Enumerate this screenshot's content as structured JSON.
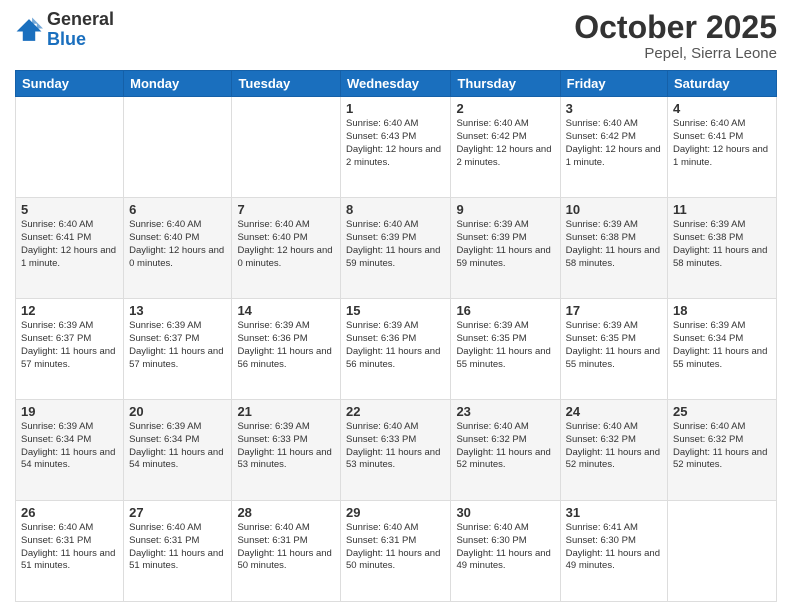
{
  "header": {
    "logo": {
      "general": "General",
      "blue": "Blue"
    },
    "title": "October 2025",
    "location": "Pepel, Sierra Leone"
  },
  "calendar": {
    "days": [
      "Sunday",
      "Monday",
      "Tuesday",
      "Wednesday",
      "Thursday",
      "Friday",
      "Saturday"
    ],
    "weeks": [
      [
        {
          "day": "",
          "info": ""
        },
        {
          "day": "",
          "info": ""
        },
        {
          "day": "",
          "info": ""
        },
        {
          "day": "1",
          "info": "Sunrise: 6:40 AM\nSunset: 6:43 PM\nDaylight: 12 hours\nand 2 minutes."
        },
        {
          "day": "2",
          "info": "Sunrise: 6:40 AM\nSunset: 6:42 PM\nDaylight: 12 hours\nand 2 minutes."
        },
        {
          "day": "3",
          "info": "Sunrise: 6:40 AM\nSunset: 6:42 PM\nDaylight: 12 hours\nand 1 minute."
        },
        {
          "day": "4",
          "info": "Sunrise: 6:40 AM\nSunset: 6:41 PM\nDaylight: 12 hours\nand 1 minute."
        }
      ],
      [
        {
          "day": "5",
          "info": "Sunrise: 6:40 AM\nSunset: 6:41 PM\nDaylight: 12 hours\nand 1 minute."
        },
        {
          "day": "6",
          "info": "Sunrise: 6:40 AM\nSunset: 6:40 PM\nDaylight: 12 hours\nand 0 minutes."
        },
        {
          "day": "7",
          "info": "Sunrise: 6:40 AM\nSunset: 6:40 PM\nDaylight: 12 hours\nand 0 minutes."
        },
        {
          "day": "8",
          "info": "Sunrise: 6:40 AM\nSunset: 6:39 PM\nDaylight: 11 hours\nand 59 minutes."
        },
        {
          "day": "9",
          "info": "Sunrise: 6:39 AM\nSunset: 6:39 PM\nDaylight: 11 hours\nand 59 minutes."
        },
        {
          "day": "10",
          "info": "Sunrise: 6:39 AM\nSunset: 6:38 PM\nDaylight: 11 hours\nand 58 minutes."
        },
        {
          "day": "11",
          "info": "Sunrise: 6:39 AM\nSunset: 6:38 PM\nDaylight: 11 hours\nand 58 minutes."
        }
      ],
      [
        {
          "day": "12",
          "info": "Sunrise: 6:39 AM\nSunset: 6:37 PM\nDaylight: 11 hours\nand 57 minutes."
        },
        {
          "day": "13",
          "info": "Sunrise: 6:39 AM\nSunset: 6:37 PM\nDaylight: 11 hours\nand 57 minutes."
        },
        {
          "day": "14",
          "info": "Sunrise: 6:39 AM\nSunset: 6:36 PM\nDaylight: 11 hours\nand 56 minutes."
        },
        {
          "day": "15",
          "info": "Sunrise: 6:39 AM\nSunset: 6:36 PM\nDaylight: 11 hours\nand 56 minutes."
        },
        {
          "day": "16",
          "info": "Sunrise: 6:39 AM\nSunset: 6:35 PM\nDaylight: 11 hours\nand 55 minutes."
        },
        {
          "day": "17",
          "info": "Sunrise: 6:39 AM\nSunset: 6:35 PM\nDaylight: 11 hours\nand 55 minutes."
        },
        {
          "day": "18",
          "info": "Sunrise: 6:39 AM\nSunset: 6:34 PM\nDaylight: 11 hours\nand 55 minutes."
        }
      ],
      [
        {
          "day": "19",
          "info": "Sunrise: 6:39 AM\nSunset: 6:34 PM\nDaylight: 11 hours\nand 54 minutes."
        },
        {
          "day": "20",
          "info": "Sunrise: 6:39 AM\nSunset: 6:34 PM\nDaylight: 11 hours\nand 54 minutes."
        },
        {
          "day": "21",
          "info": "Sunrise: 6:39 AM\nSunset: 6:33 PM\nDaylight: 11 hours\nand 53 minutes."
        },
        {
          "day": "22",
          "info": "Sunrise: 6:40 AM\nSunset: 6:33 PM\nDaylight: 11 hours\nand 53 minutes."
        },
        {
          "day": "23",
          "info": "Sunrise: 6:40 AM\nSunset: 6:32 PM\nDaylight: 11 hours\nand 52 minutes."
        },
        {
          "day": "24",
          "info": "Sunrise: 6:40 AM\nSunset: 6:32 PM\nDaylight: 11 hours\nand 52 minutes."
        },
        {
          "day": "25",
          "info": "Sunrise: 6:40 AM\nSunset: 6:32 PM\nDaylight: 11 hours\nand 52 minutes."
        }
      ],
      [
        {
          "day": "26",
          "info": "Sunrise: 6:40 AM\nSunset: 6:31 PM\nDaylight: 11 hours\nand 51 minutes."
        },
        {
          "day": "27",
          "info": "Sunrise: 6:40 AM\nSunset: 6:31 PM\nDaylight: 11 hours\nand 51 minutes."
        },
        {
          "day": "28",
          "info": "Sunrise: 6:40 AM\nSunset: 6:31 PM\nDaylight: 11 hours\nand 50 minutes."
        },
        {
          "day": "29",
          "info": "Sunrise: 6:40 AM\nSunset: 6:31 PM\nDaylight: 11 hours\nand 50 minutes."
        },
        {
          "day": "30",
          "info": "Sunrise: 6:40 AM\nSunset: 6:30 PM\nDaylight: 11 hours\nand 49 minutes."
        },
        {
          "day": "31",
          "info": "Sunrise: 6:41 AM\nSunset: 6:30 PM\nDaylight: 11 hours\nand 49 minutes."
        },
        {
          "day": "",
          "info": ""
        }
      ]
    ]
  }
}
